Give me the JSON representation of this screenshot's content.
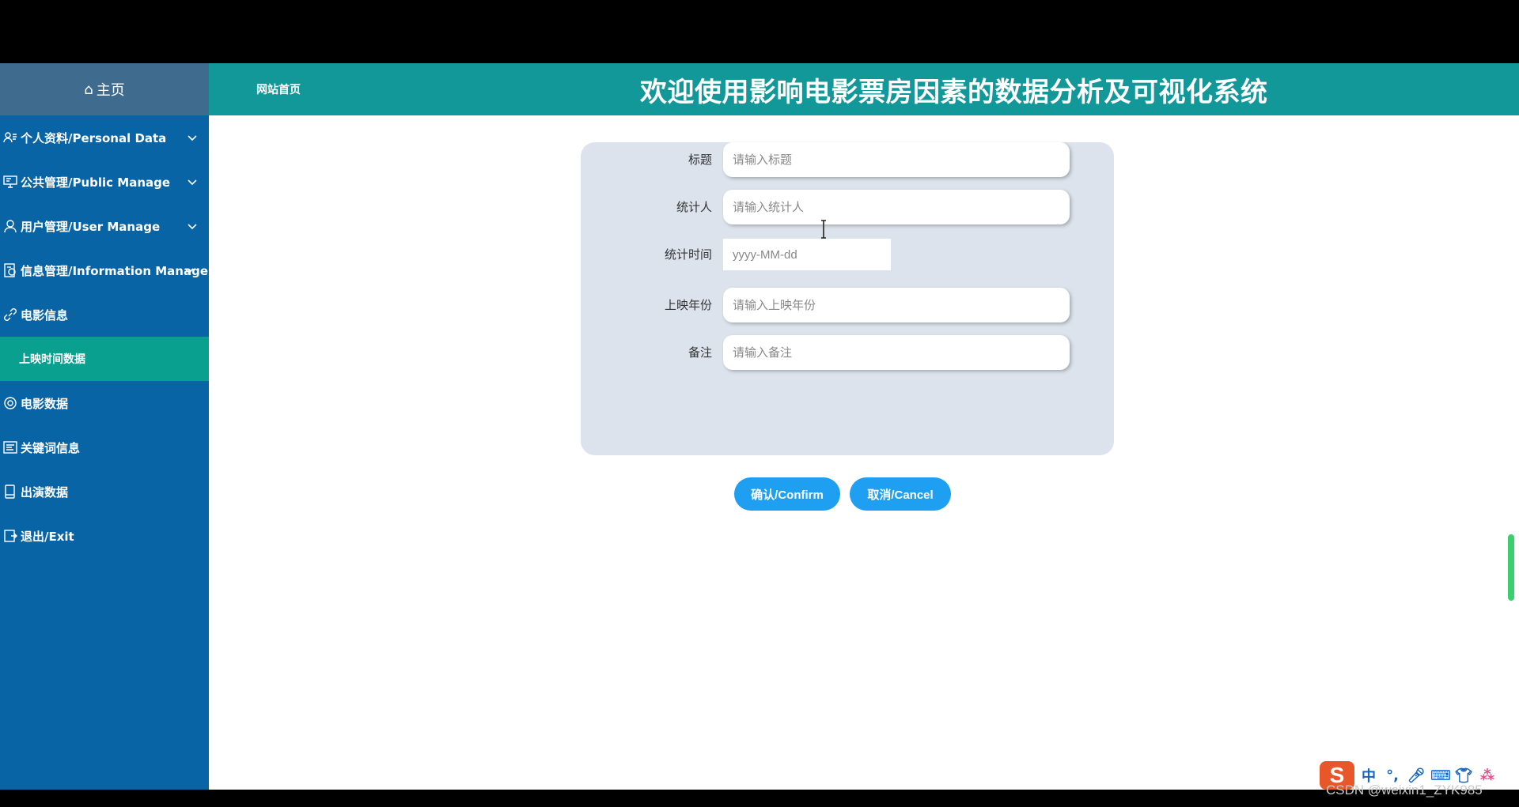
{
  "sidebar": {
    "home_label": "主页",
    "items": [
      {
        "label": "个人资料/Personal Data",
        "icon": "user-card-icon",
        "expandable": true
      },
      {
        "label": "公共管理/Public Manage",
        "icon": "monitor-icon",
        "expandable": true
      },
      {
        "label": "用户管理/User Manage",
        "icon": "user-icon",
        "expandable": true
      },
      {
        "label": "信息管理/Information Manage",
        "icon": "info-doc-icon",
        "expandable": true
      },
      {
        "label": "电影信息",
        "icon": "link-icon",
        "expandable": false
      },
      {
        "label": "上映时间数据",
        "icon": "",
        "expandable": false,
        "active": true
      },
      {
        "label": "电影数据",
        "icon": "gear-circle-icon",
        "expandable": false
      },
      {
        "label": "关键词信息",
        "icon": "list-doc-icon",
        "expandable": false
      },
      {
        "label": "出演数据",
        "icon": "tablet-icon",
        "expandable": false
      },
      {
        "label": "退出/Exit",
        "icon": "exit-icon",
        "expandable": false
      }
    ]
  },
  "header": {
    "home_link": "网站首页",
    "title": "欢迎使用影响电影票房因素的数据分析及可视化系统"
  },
  "form": {
    "fields": [
      {
        "label": "标题",
        "placeholder": "请输入标题"
      },
      {
        "label": "统计人",
        "placeholder": "请输入统计人"
      },
      {
        "label": "统计时间",
        "placeholder": "yyyy-MM-dd"
      },
      {
        "label": "上映年份",
        "placeholder": "请输入上映年份"
      },
      {
        "label": "备注",
        "placeholder": "请输入备注"
      }
    ],
    "confirm_label": "确认/Confirm",
    "cancel_label": "取消/Cancel"
  },
  "taskbar": {
    "ime_logo": "S",
    "ime_mode": "中",
    "watermark": "CSDN @weixin1_ZYK985"
  },
  "colors": {
    "sidebar": "#0864a5",
    "header": "#13989a",
    "active_item": "#09a08f",
    "button": "#1e9ff2",
    "card": "#dce3ec"
  }
}
